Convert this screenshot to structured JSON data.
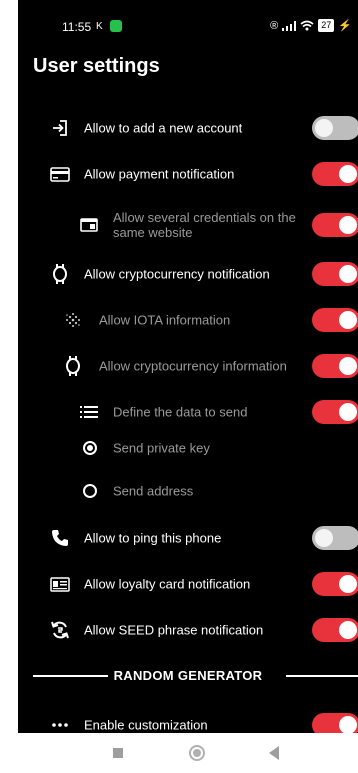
{
  "status_bar": {
    "time": "11:55",
    "k_indicator": "K",
    "right_symbols": "®",
    "battery": "27"
  },
  "title": "User settings",
  "settings": {
    "add_account": {
      "label": "Allow to add a new account",
      "enabled": false,
      "icon": "login-icon"
    },
    "payment_notification": {
      "label": "Allow payment notification",
      "enabled": true,
      "icon": "credit-card-icon"
    },
    "several_credentials": {
      "label": "Allow several credentials on the same website",
      "enabled": true,
      "icon": "card-icon"
    },
    "crypto_notification": {
      "label": "Allow cryptocurrency notification",
      "enabled": true,
      "icon": "crypto-icon"
    },
    "iota_information": {
      "label": "Allow IOTA information",
      "enabled": true,
      "icon": "iota-icon"
    },
    "crypto_information": {
      "label": "Allow cryptocurrency information",
      "enabled": true,
      "icon": "crypto-icon"
    },
    "define_data": {
      "label": "Define the data to send",
      "enabled": true,
      "icon": "list-icon"
    },
    "send_private_key": {
      "label": "Send private key",
      "selected": true
    },
    "send_address": {
      "label": "Send address",
      "selected": false
    },
    "ping_phone": {
      "label": "Allow to ping this phone",
      "enabled": false,
      "icon": "phone-icon"
    },
    "loyalty_card": {
      "label": "Allow loyalty card notification",
      "enabled": true,
      "icon": "id-card-icon"
    },
    "seed_phrase": {
      "label": "Allow SEED phrase notification",
      "enabled": true,
      "icon": "sync-icon"
    }
  },
  "random_generator": {
    "heading": "RANDOM GENERATOR",
    "enable_customization": {
      "label": "Enable customization",
      "enabled": true,
      "icon": "more-dots-icon"
    }
  },
  "colors": {
    "toggle_on": "#e8323c",
    "toggle_off": "#bdbdbd",
    "background": "#000000",
    "dim_text": "#9a9a9a"
  }
}
